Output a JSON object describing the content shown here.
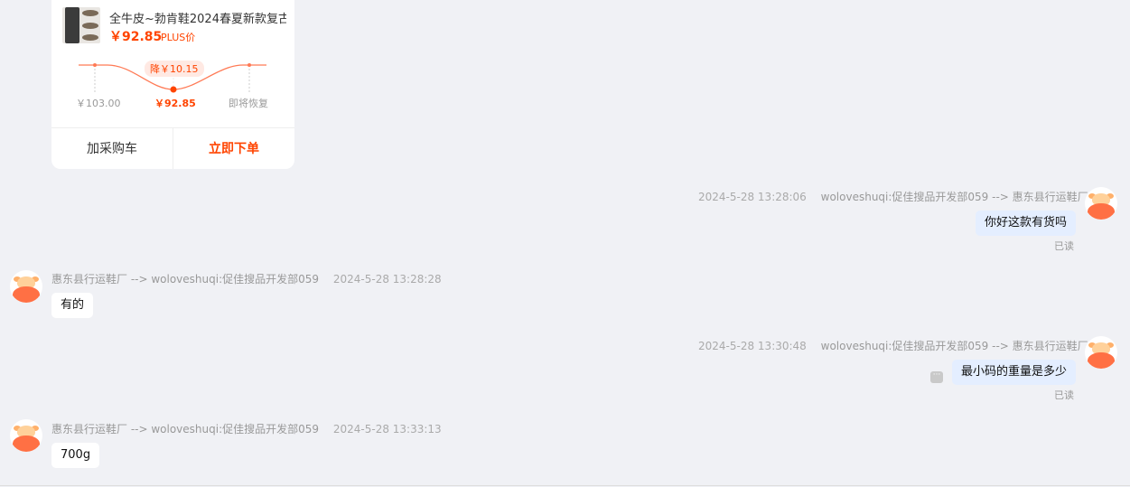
{
  "product": {
    "title": "全牛皮~勃肯鞋2024春夏新款复古",
    "price": "￥92.85",
    "plus_label": "PLUS价",
    "drop_badge": "降￥10.15",
    "price_points": [
      "￥103.00",
      "￥92.85",
      "即将恢复"
    ],
    "add_cart_label": "加采购车",
    "buy_now_label": "立即下单"
  },
  "messages": [
    {
      "direction": "out",
      "timestamp": "2024-5-28 13:28:06",
      "route": "woloveshuqi:促佳搜品开发部059 --> 惠东县行运鞋厂",
      "text": "你好这款有货吗",
      "read_status": "已读"
    },
    {
      "direction": "in",
      "route": "惠东县行运鞋厂 --> woloveshuqi:促佳搜品开发部059",
      "timestamp": "2024-5-28 13:28:28",
      "text": "有的"
    },
    {
      "direction": "out",
      "timestamp": "2024-5-28 13:30:48",
      "route": "woloveshuqi:促佳搜品开发部059 --> 惠东县行运鞋厂",
      "text": "最小码的重量是多少",
      "read_status": "已读"
    },
    {
      "direction": "in",
      "route": "惠东县行运鞋厂 --> woloveshuqi:促佳搜品开发部059",
      "timestamp": "2024-5-28 13:33:13",
      "text": "700g"
    }
  ],
  "colors": {
    "accent": "#ff4400",
    "outgoing_bubble": "#e4eeff",
    "background": "#f0f1f5"
  },
  "icons": [
    "avatar-icon",
    "more-options-icon"
  ]
}
